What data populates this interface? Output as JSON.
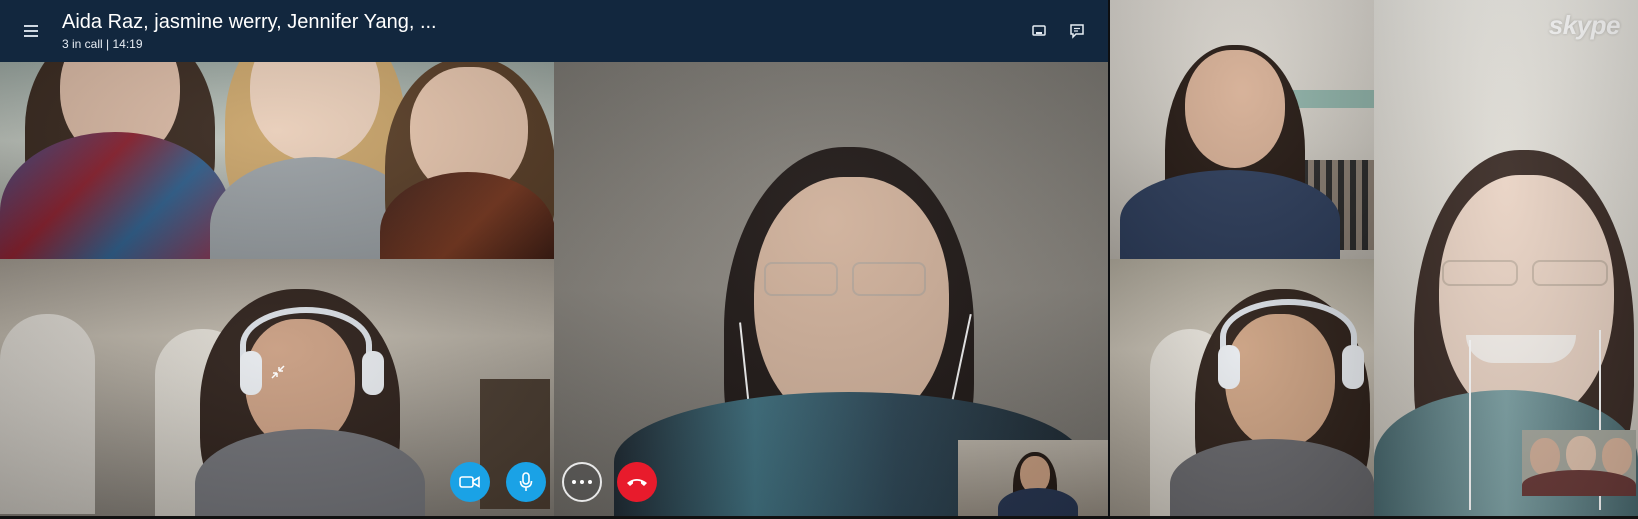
{
  "call": {
    "participants_title": "Aida Raz, jasmine werry, Jennifer Yang, ...",
    "status": "3 in call | 14:19"
  },
  "header": {
    "menu_icon": "hamburger-list-icon",
    "right_icons": [
      "monitor-icon",
      "chat-icon"
    ]
  },
  "controls": {
    "video_icon": "video-camera-icon",
    "mic_icon": "microphone-icon",
    "more_icon": "more-options-icon",
    "end_icon": "hang-up-icon",
    "exit_fullscreen_icon": "minimize-arrows-icon"
  },
  "brand": {
    "logo_text": "skype"
  },
  "colors": {
    "header_bg": "#10273f",
    "accent_blue": "#1aa2e6",
    "end_call_red": "#e81b2c"
  }
}
